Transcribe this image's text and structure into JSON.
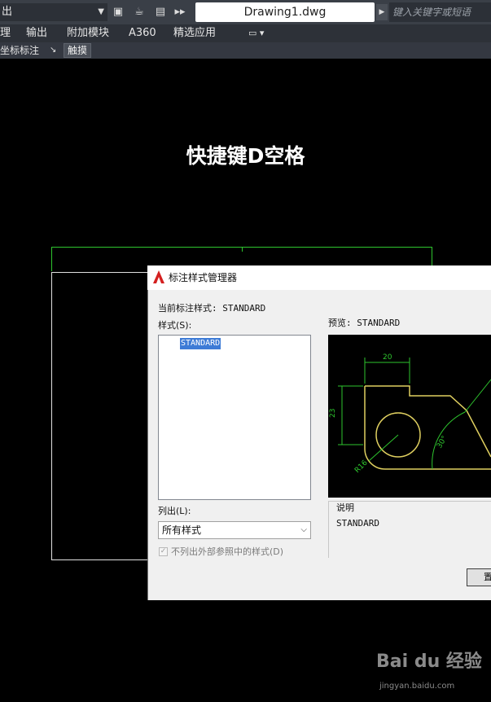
{
  "quick_access": {
    "dropdown_label": "出",
    "title": "Drawing1.dwg",
    "search_placeholder": "键入关键字或短语"
  },
  "menu": {
    "items": [
      "理",
      "输出",
      "附加模块",
      "A360",
      "精选应用"
    ]
  },
  "toolbar2": {
    "coord_label": "坐标标注",
    "touch_label": "触摸"
  },
  "caption": "快捷键D空格",
  "dialog": {
    "title": "标注样式管理器",
    "current_style_label": "当前标注样式: STANDARD",
    "styles_label": "样式(S):",
    "styles": [
      "STANDARD"
    ],
    "list_label": "列出(L):",
    "list_value": "所有样式",
    "exclude_xref_label": "不列出外部参照中的样式(D)",
    "preview_label": "预览: STANDARD",
    "description_label": "说明",
    "description_value": "STANDARD",
    "partial_button": "置"
  },
  "preview_drawing": {
    "dim_horizontal": "20",
    "dim_vertical": "23",
    "dim_radius": "R16",
    "dim_angle": "30°",
    "colors": {
      "geometry": "#e0d060",
      "dimension": "#2ec52e",
      "outline": "#e0e0e0"
    }
  },
  "watermark": {
    "brand": "Bai du 经验",
    "url": "jingyan.baidu.com"
  }
}
